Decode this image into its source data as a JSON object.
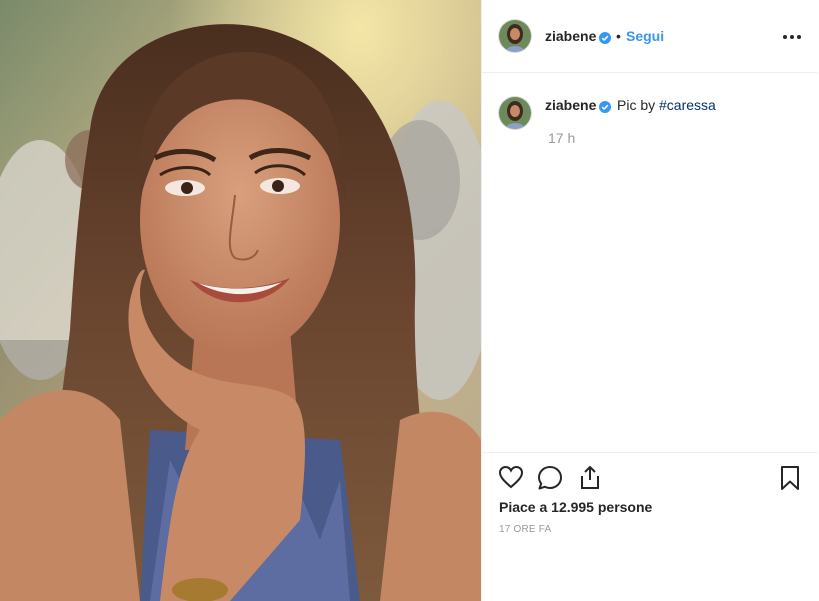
{
  "post": {
    "username": "ziabene",
    "verified": true,
    "dot": "•",
    "follow_label": "Segui",
    "caption_text": "Pic by ",
    "caption_tag": "#caressa",
    "time_relative": "17 h",
    "likes_text": "Piace a 12.995 persone",
    "posted_ago": "17 ORE FA"
  },
  "colors": {
    "accent": "#3897f0",
    "hashtag": "#003569",
    "muted": "#999999",
    "text": "#262626"
  },
  "icons": {
    "more": "more-options-icon",
    "like": "heart-icon",
    "comment": "comment-icon",
    "share": "share-icon",
    "save": "bookmark-icon",
    "verified": "verified-badge-icon"
  }
}
